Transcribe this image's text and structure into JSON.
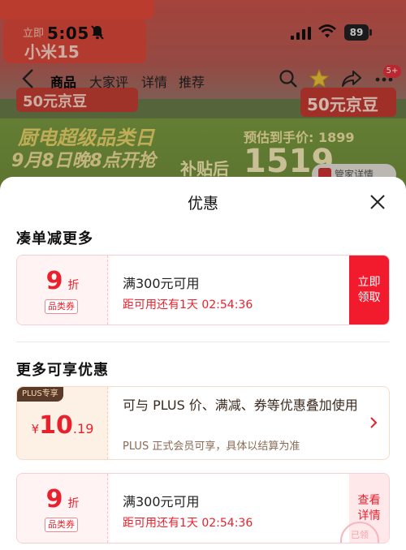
{
  "status_bar": {
    "time": "5:05",
    "battery": "89"
  },
  "background": {
    "promo_chip_label": "立即",
    "promo_chip_name": "小米15",
    "beans_left": "50元京豆",
    "beans_right": "50元京豆",
    "ad_title": "厨电超级品类日",
    "ad_subtitle": "9月8日晚8点开抢",
    "estimate": "预估到手价: 1899",
    "subsidy_prefix": "补贴后",
    "subsidy_price": "1519",
    "pill_text": "管家详情"
  },
  "nav": {
    "tabs": [
      {
        "label": "商品"
      },
      {
        "label": "大家评"
      },
      {
        "label": "详情"
      },
      {
        "label": "推荐"
      }
    ],
    "badge": "5+"
  },
  "sheet": {
    "title": "优惠",
    "section1_title": "凑单减更多",
    "section2_title": "更多可享优惠",
    "coupon1": {
      "discount": "9",
      "unit": "折",
      "tag": "品类券",
      "condition": "满300元可用",
      "expiry": "距可用还有1天 02:54:36",
      "action": "立即领取"
    },
    "plus": {
      "tag": "PLUS专享",
      "currency": "¥",
      "price_int": "10",
      "price_dec": ".19",
      "description": "可与 PLUS 价、满减、券等优惠叠加使用",
      "note": "PLUS 正式会员可享，具体以结算为准"
    },
    "coupon2": {
      "discount": "9",
      "unit": "折",
      "tag": "品类券",
      "condition": "满300元可用",
      "expiry": "距可用还有1天 02:54:36",
      "action": "查看详情",
      "stamp": "已领"
    }
  },
  "colors": {
    "accent": "#f21b2e",
    "price_red": "#e8212c",
    "plus_brown": "#5a3b2a"
  }
}
